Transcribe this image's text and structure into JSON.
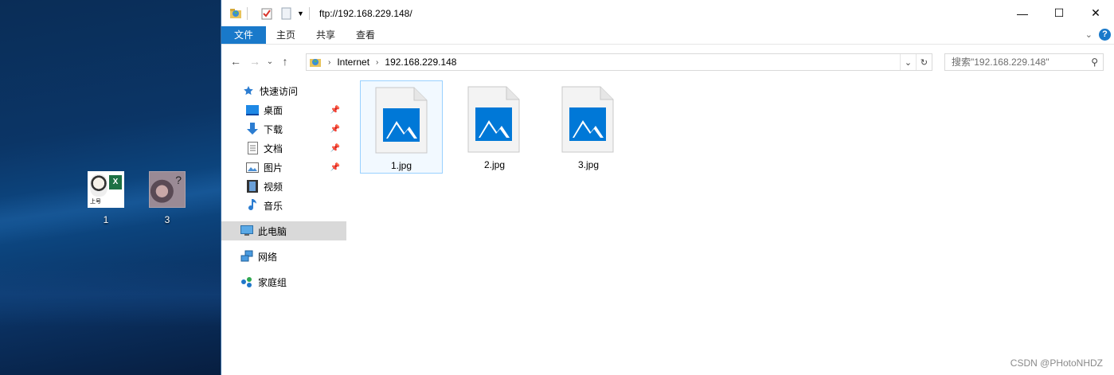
{
  "desktop": {
    "icons": [
      {
        "label": "1",
        "icon": "excel-image-thumbnail"
      },
      {
        "label": "3",
        "icon": "photo-thumbnail"
      }
    ]
  },
  "titlebar": {
    "title": "ftp://192.168.229.148/",
    "controls": {
      "minimize": "—",
      "maximize": "☐",
      "close": "✕"
    }
  },
  "ribbon": {
    "tabs": [
      {
        "label": "文件",
        "active": true
      },
      {
        "label": "主页",
        "active": false
      },
      {
        "label": "共享",
        "active": false
      },
      {
        "label": "查看",
        "active": false
      }
    ],
    "help": "?"
  },
  "navbar": {
    "back": "←",
    "forward": "→",
    "recent": "⌄",
    "up": "↑",
    "breadcrumb": [
      "Internet",
      "192.168.229.148"
    ],
    "search_placeholder": "搜索\"192.168.229.148\""
  },
  "sidebar": {
    "quick_access": "快速访问",
    "items": [
      {
        "label": "桌面",
        "icon": "desktop-icon",
        "pinned": true
      },
      {
        "label": "下载",
        "icon": "download-icon",
        "pinned": true
      },
      {
        "label": "文档",
        "icon": "document-icon",
        "pinned": true
      },
      {
        "label": "图片",
        "icon": "pictures-icon",
        "pinned": true
      },
      {
        "label": "视频",
        "icon": "video-icon",
        "pinned": false
      },
      {
        "label": "音乐",
        "icon": "music-icon",
        "pinned": false
      }
    ],
    "this_pc": "此电脑",
    "network": "网络",
    "homegroup": "家庭组"
  },
  "files": [
    {
      "name": "1.jpg",
      "selected": true
    },
    {
      "name": "2.jpg",
      "selected": false
    },
    {
      "name": "3.jpg",
      "selected": false
    }
  ],
  "watermark": "CSDN @PHotoNHDZ",
  "colors": {
    "accent": "#1979ca",
    "file_icon": "#0078d7",
    "desktop_bg": "#0b3566"
  }
}
